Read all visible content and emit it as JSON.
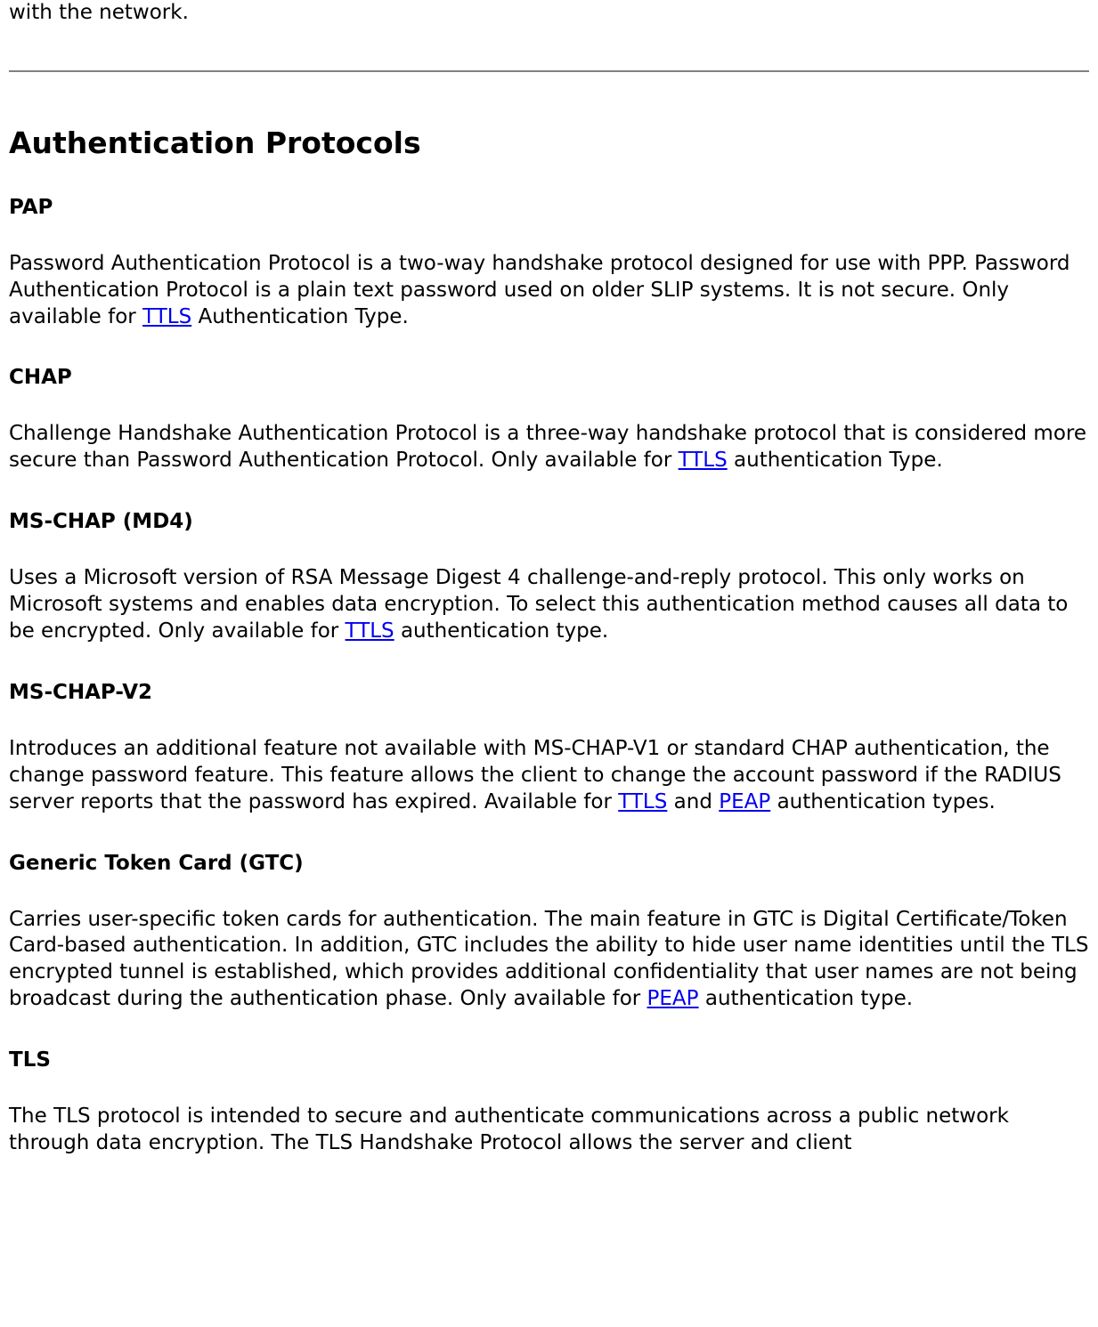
{
  "leadin": "with the network.",
  "section_title": "Authentication Protocols",
  "links": {
    "ttls": "TTLS",
    "peap": "PEAP"
  },
  "pap": {
    "heading": "PAP",
    "before_link": "Password Authentication Protocol is a two-way handshake protocol designed for use with PPP. Password Authentication Protocol is a plain text password used on older SLIP systems. It is not secure. Only available for ",
    "after_link": " Authentication Type."
  },
  "chap": {
    "heading": "CHAP",
    "before_link": "Challenge Handshake Authentication Protocol is a three-way handshake protocol that is considered more secure than Password Authentication Protocol. Only available for ",
    "after_link": " authentication Type."
  },
  "mschap": {
    "heading": "MS-CHAP (MD4)",
    "before_link": "Uses a Microsoft version of RSA Message Digest 4 challenge-and-reply protocol. This only works on Microsoft systems and enables data encryption. To select this authentication method causes all data to be encrypted. Only available for ",
    "after_link": " authentication type."
  },
  "mschapv2": {
    "heading": "MS-CHAP-V2",
    "before_first": "Introduces an additional feature not available with MS-CHAP-V1 or standard CHAP authentication, the change password feature. This feature allows the client to change the account password if the RADIUS server reports that the password has expired. Available for ",
    "between": " and ",
    "after_second": " authentication types."
  },
  "gtc": {
    "heading": "Generic Token Card (GTC)",
    "before_link": "Carries user-specific token cards for authentication. The main feature in GTC is Digital Certificate/Token Card-based authentication. In addition, GTC includes the ability to hide user name identities until the TLS encrypted tunnel is established, which provides additional confidentiality that user names are not being broadcast during the authentication phase. Only available for ",
    "after_link": " authentication type."
  },
  "tls": {
    "heading": "TLS",
    "body": "The TLS protocol is intended to secure and authenticate communications across a public network through data encryption. The TLS Handshake Protocol allows the server and client"
  }
}
